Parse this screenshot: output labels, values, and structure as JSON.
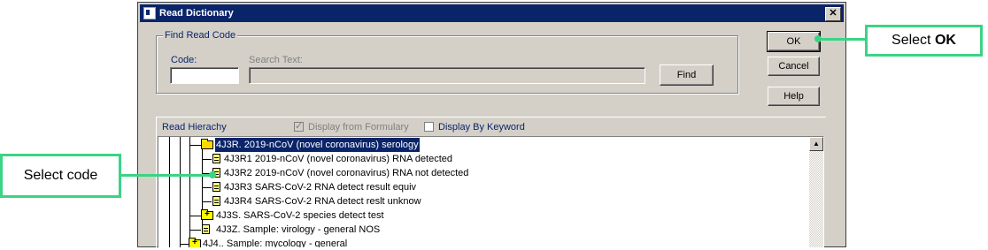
{
  "window": {
    "title": "Read Dictionary",
    "close_glyph": "✕"
  },
  "find": {
    "group_label": "Find Read Code",
    "code_label": "Code:",
    "code_value": "",
    "search_label": "Search Text:",
    "search_value": "",
    "find_button": "Find"
  },
  "buttons": {
    "ok": "OK",
    "cancel": "Cancel",
    "help": "Help"
  },
  "hierarchy": {
    "label": "Read Hierachy",
    "display_formulary_label": "Display from Formulary",
    "display_formulary_checked": true,
    "display_keyword_label": "Display By Keyword",
    "display_keyword_checked": false,
    "rows": [
      {
        "text": "4J3R. 2019-nCoV (novel coronavirus) serology",
        "icon": "folder-open-icon",
        "selected": true
      },
      {
        "text": "4J3R1 2019-nCoV (novel coronavirus) RNA detected",
        "icon": "document-icon",
        "selected": false
      },
      {
        "text": "4J3R2 2019-nCoV (novel coronavirus) RNA not detected",
        "icon": "document-icon",
        "selected": false
      },
      {
        "text": "4J3R3 SARS-CoV-2 RNA detect result equiv",
        "icon": "document-icon",
        "selected": false
      },
      {
        "text": "4J3R4 SARS-CoV-2 RNA detect reslt unknow",
        "icon": "document-icon",
        "selected": false
      },
      {
        "text": "4J3S. SARS-CoV-2 species detect test",
        "icon": "folder-plus-icon",
        "selected": false
      },
      {
        "text": "4J3Z. Sample: virology - general NOS",
        "icon": "document-icon",
        "selected": false
      },
      {
        "text": "4J4.. Sample: mycology - general",
        "icon": "folder-plus-icon",
        "selected": false
      }
    ]
  },
  "callouts": {
    "ok_prefix": "Select ",
    "ok_bold": "OK",
    "code": "Select code",
    "color": "#3ad484"
  }
}
